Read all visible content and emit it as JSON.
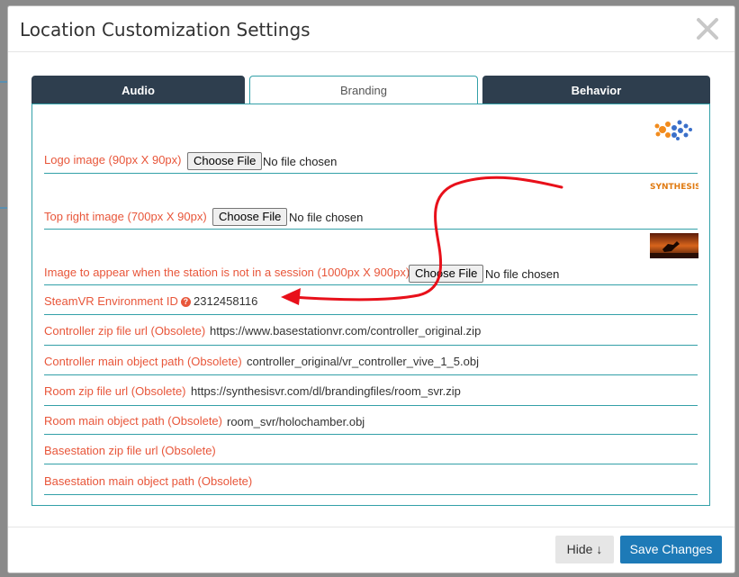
{
  "dialog": {
    "title": "Location Customization Settings"
  },
  "tabs": [
    {
      "label": "Audio"
    },
    {
      "label": "Branding"
    },
    {
      "label": "Behavior"
    }
  ],
  "fields": {
    "logo_image": {
      "label": "Logo image (90px X 90px)",
      "button": "Choose File",
      "status": "No file chosen"
    },
    "top_right_image": {
      "label": "Top right image (700px X 90px)",
      "button": "Choose File",
      "status": "No file chosen"
    },
    "idle_image": {
      "label": "Image to appear when the station is not in a session (1000px X 900px)",
      "button": "Choose File",
      "status": "No file chosen"
    },
    "steamvr_env": {
      "label": "SteamVR Environment ID",
      "value": "2312458116"
    },
    "controller_zip": {
      "label": "Controller zip file url (Obsolete)",
      "value": "https://www.basestationvr.com/controller_original.zip"
    },
    "controller_obj": {
      "label": "Controller main object path (Obsolete)",
      "value": "controller_original/vr_controller_vive_1_5.obj"
    },
    "room_zip": {
      "label": "Room zip file url (Obsolete)",
      "value": "https://synthesisvr.com/dl/brandingfiles/room_svr.zip"
    },
    "room_obj": {
      "label": "Room main object path (Obsolete)",
      "value": "room_svr/holochamber.obj"
    },
    "basestation_zip": {
      "label": "Basestation zip file url (Obsolete)",
      "value": ""
    },
    "basestation_obj": {
      "label": "Basestation main object path (Obsolete)",
      "value": ""
    }
  },
  "thumbnails": {
    "top_right_text": "SYNTHESISVR"
  },
  "footer": {
    "hide_label": "Hide ↓",
    "save_label": "Save Changes"
  },
  "colors": {
    "tab_dark": "#2e3e4e",
    "accent": "#33a0a8",
    "label": "#e8563a",
    "primary_button": "#1d7ab7",
    "annotation_arrow": "#e8101a"
  },
  "icons": {
    "close": "close-icon",
    "help": "help-icon",
    "arrow_annotation": "arrow-annotation"
  }
}
